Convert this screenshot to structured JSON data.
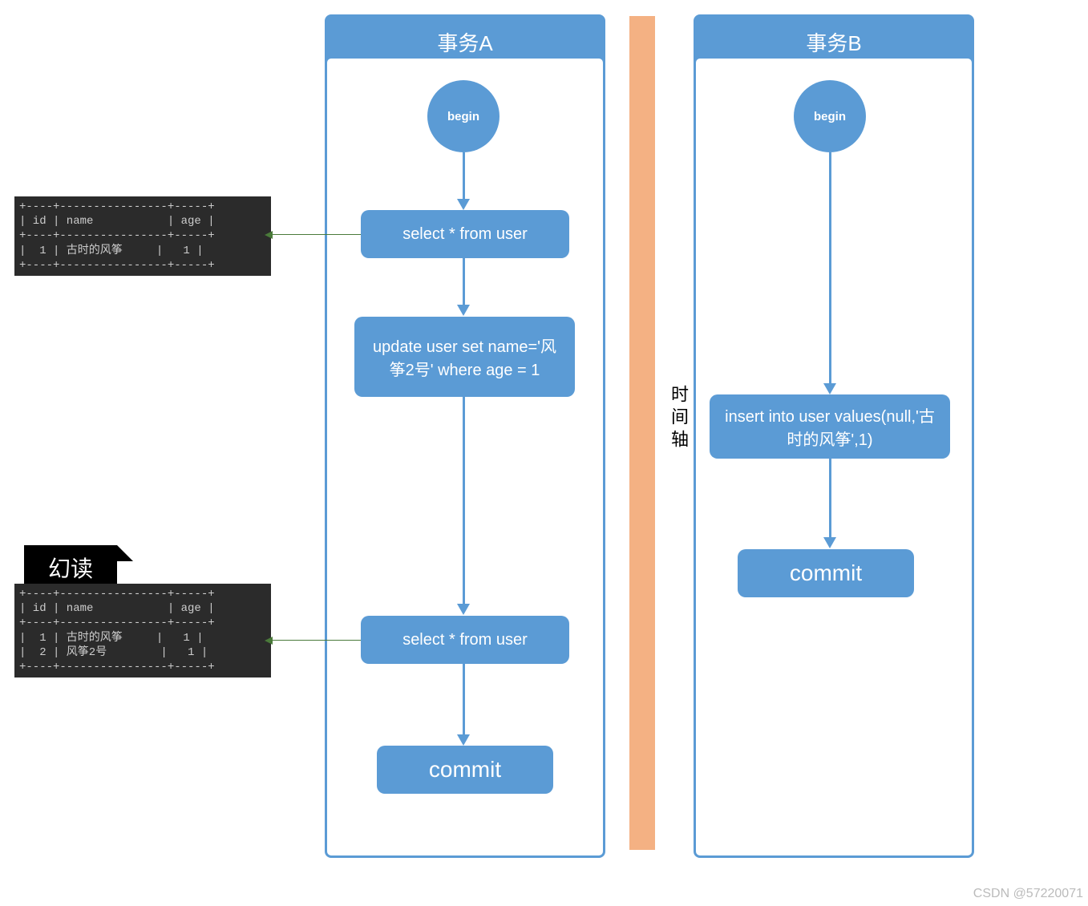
{
  "txA": {
    "title": "事务A",
    "begin": "begin",
    "step1": "select * from user",
    "step2": "update user set name='风筝2号' where age = 1",
    "step3": "select * from user",
    "commit": "commit"
  },
  "txB": {
    "title": "事务B",
    "begin": "begin",
    "step1": "insert into user values(null,'古时的风筝',1)",
    "commit": "commit"
  },
  "timeline": "时间轴",
  "console1": "+----+----------------+-----+\n| id | name           | age |\n+----+----------------+-----+\n|  1 | 古时的风筝     |   1 |\n+----+----------------+-----+",
  "console2_label": "幻读",
  "console2": "+----+----------------+-----+\n| id | name           | age |\n+----+----------------+-----+\n|  1 | 古时的风筝     |   1 |\n|  2 | 风筝2号        |   1 |\n+----+----------------+-----+",
  "watermark": "CSDN @57220071"
}
